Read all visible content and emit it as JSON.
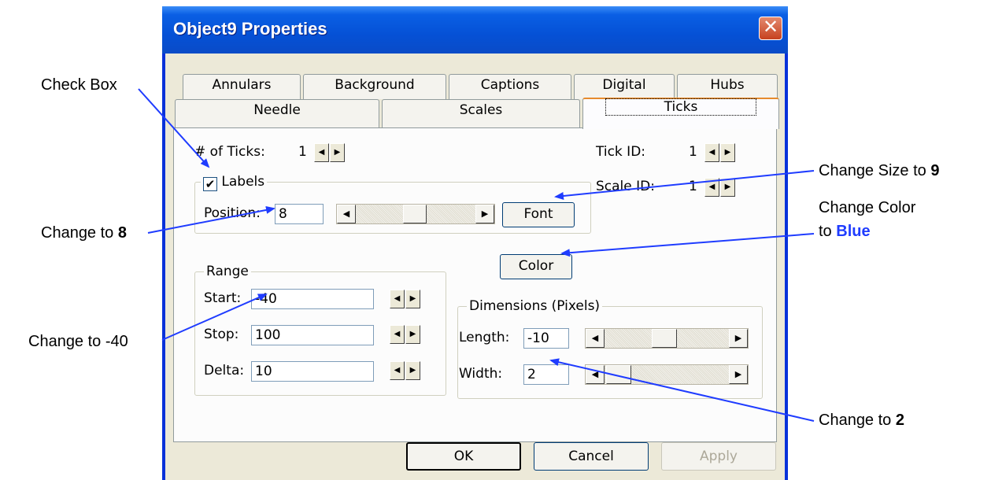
{
  "window": {
    "title": "Object9 Properties"
  },
  "tabs_row1": [
    "Annulars",
    "Background",
    "Captions",
    "Digital",
    "Hubs"
  ],
  "tabs_row2": [
    "Needle",
    "Scales",
    "Ticks"
  ],
  "ticks": {
    "num_ticks_label": "# of Ticks:",
    "num_ticks_value": "1",
    "tick_id_label": "Tick ID:",
    "tick_id_value": "1",
    "scale_id_label": "Scale ID:",
    "scale_id_value": "1",
    "labels_group": "Labels",
    "labels_checked": true,
    "position_label": "Position:",
    "position_value": "8",
    "font_button": "Font",
    "color_button": "Color",
    "range": {
      "group": "Range",
      "start_label": "Start:",
      "start_value": "-40",
      "stop_label": "Stop:",
      "stop_value": "100",
      "delta_label": "Delta:",
      "delta_value": "10"
    },
    "dimensions": {
      "group": "Dimensions (Pixels)",
      "length_label": "Length:",
      "length_value": "-10",
      "width_label": "Width:",
      "width_value": "2"
    }
  },
  "buttons": {
    "ok": "OK",
    "cancel": "Cancel",
    "apply": "Apply"
  },
  "callouts": {
    "check_box": "Check Box",
    "change_size_prefix": "Change Size to ",
    "change_size_value": "9",
    "change_color_line1": "Change Color",
    "change_color_prefix": "to ",
    "change_color_value": "Blue",
    "change_to_8_prefix": "Change to ",
    "change_to_8_value": "8",
    "change_to_minus40": "Change to -40",
    "change_to_2_prefix": "Change to ",
    "change_to_2_value": "2"
  },
  "colors": {
    "titlebar": "#0551d6",
    "dialog_bg": "#ece9d8",
    "arrow": "#1f3cff",
    "callout_emphasis": "#1f3cff"
  }
}
